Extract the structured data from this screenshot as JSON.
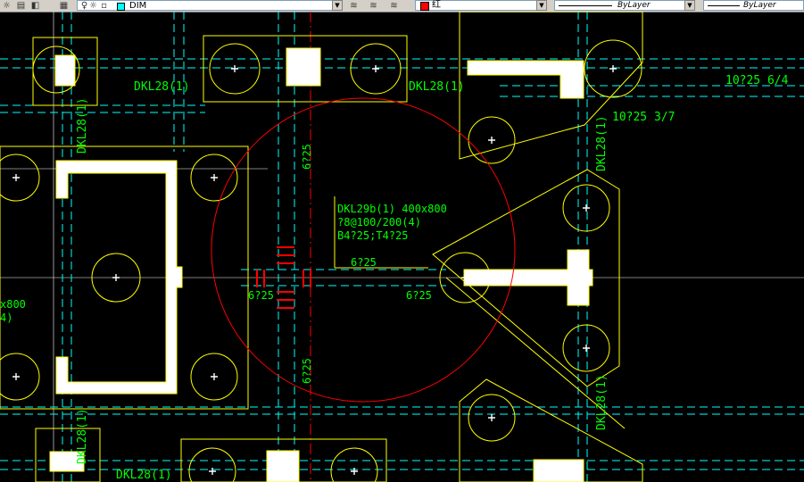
{
  "toolbar": {
    "layer_name": "DIM",
    "color_label": "红",
    "linetype_label": "ByLayer",
    "lineweight_label": "ByLayer",
    "layer_color": "#00ffff",
    "current_color": "#ff0000"
  },
  "drawing": {
    "beam_labels": {
      "top_left": "DKL28(1)",
      "top_right": "DKL28(1)",
      "left_vertical": "DKL28(1)",
      "right_vertical_upper": "DKL28(1)",
      "right_vertical_lower": "DKL28(1)",
      "bottom_left_vertical": "DKL28(1)",
      "bottom_left": "DKL28(1)"
    },
    "beam_spec": {
      "name": "DKL29b(1) 400x800",
      "stirrup": "?8@100/200(4)",
      "bars": "B4?25;T4?25"
    },
    "rebar_notes": {
      "top_right_1": "10?25 6/4",
      "top_right_2": "10?25 3/7",
      "vert_upper": "6?25",
      "vert_lower": "6?25",
      "horiz_left": "6?25",
      "horiz_mid": "6?25",
      "horiz_right": "6?25"
    },
    "cut_text_left_1": "x800",
    "cut_text_left_2": "4)"
  }
}
